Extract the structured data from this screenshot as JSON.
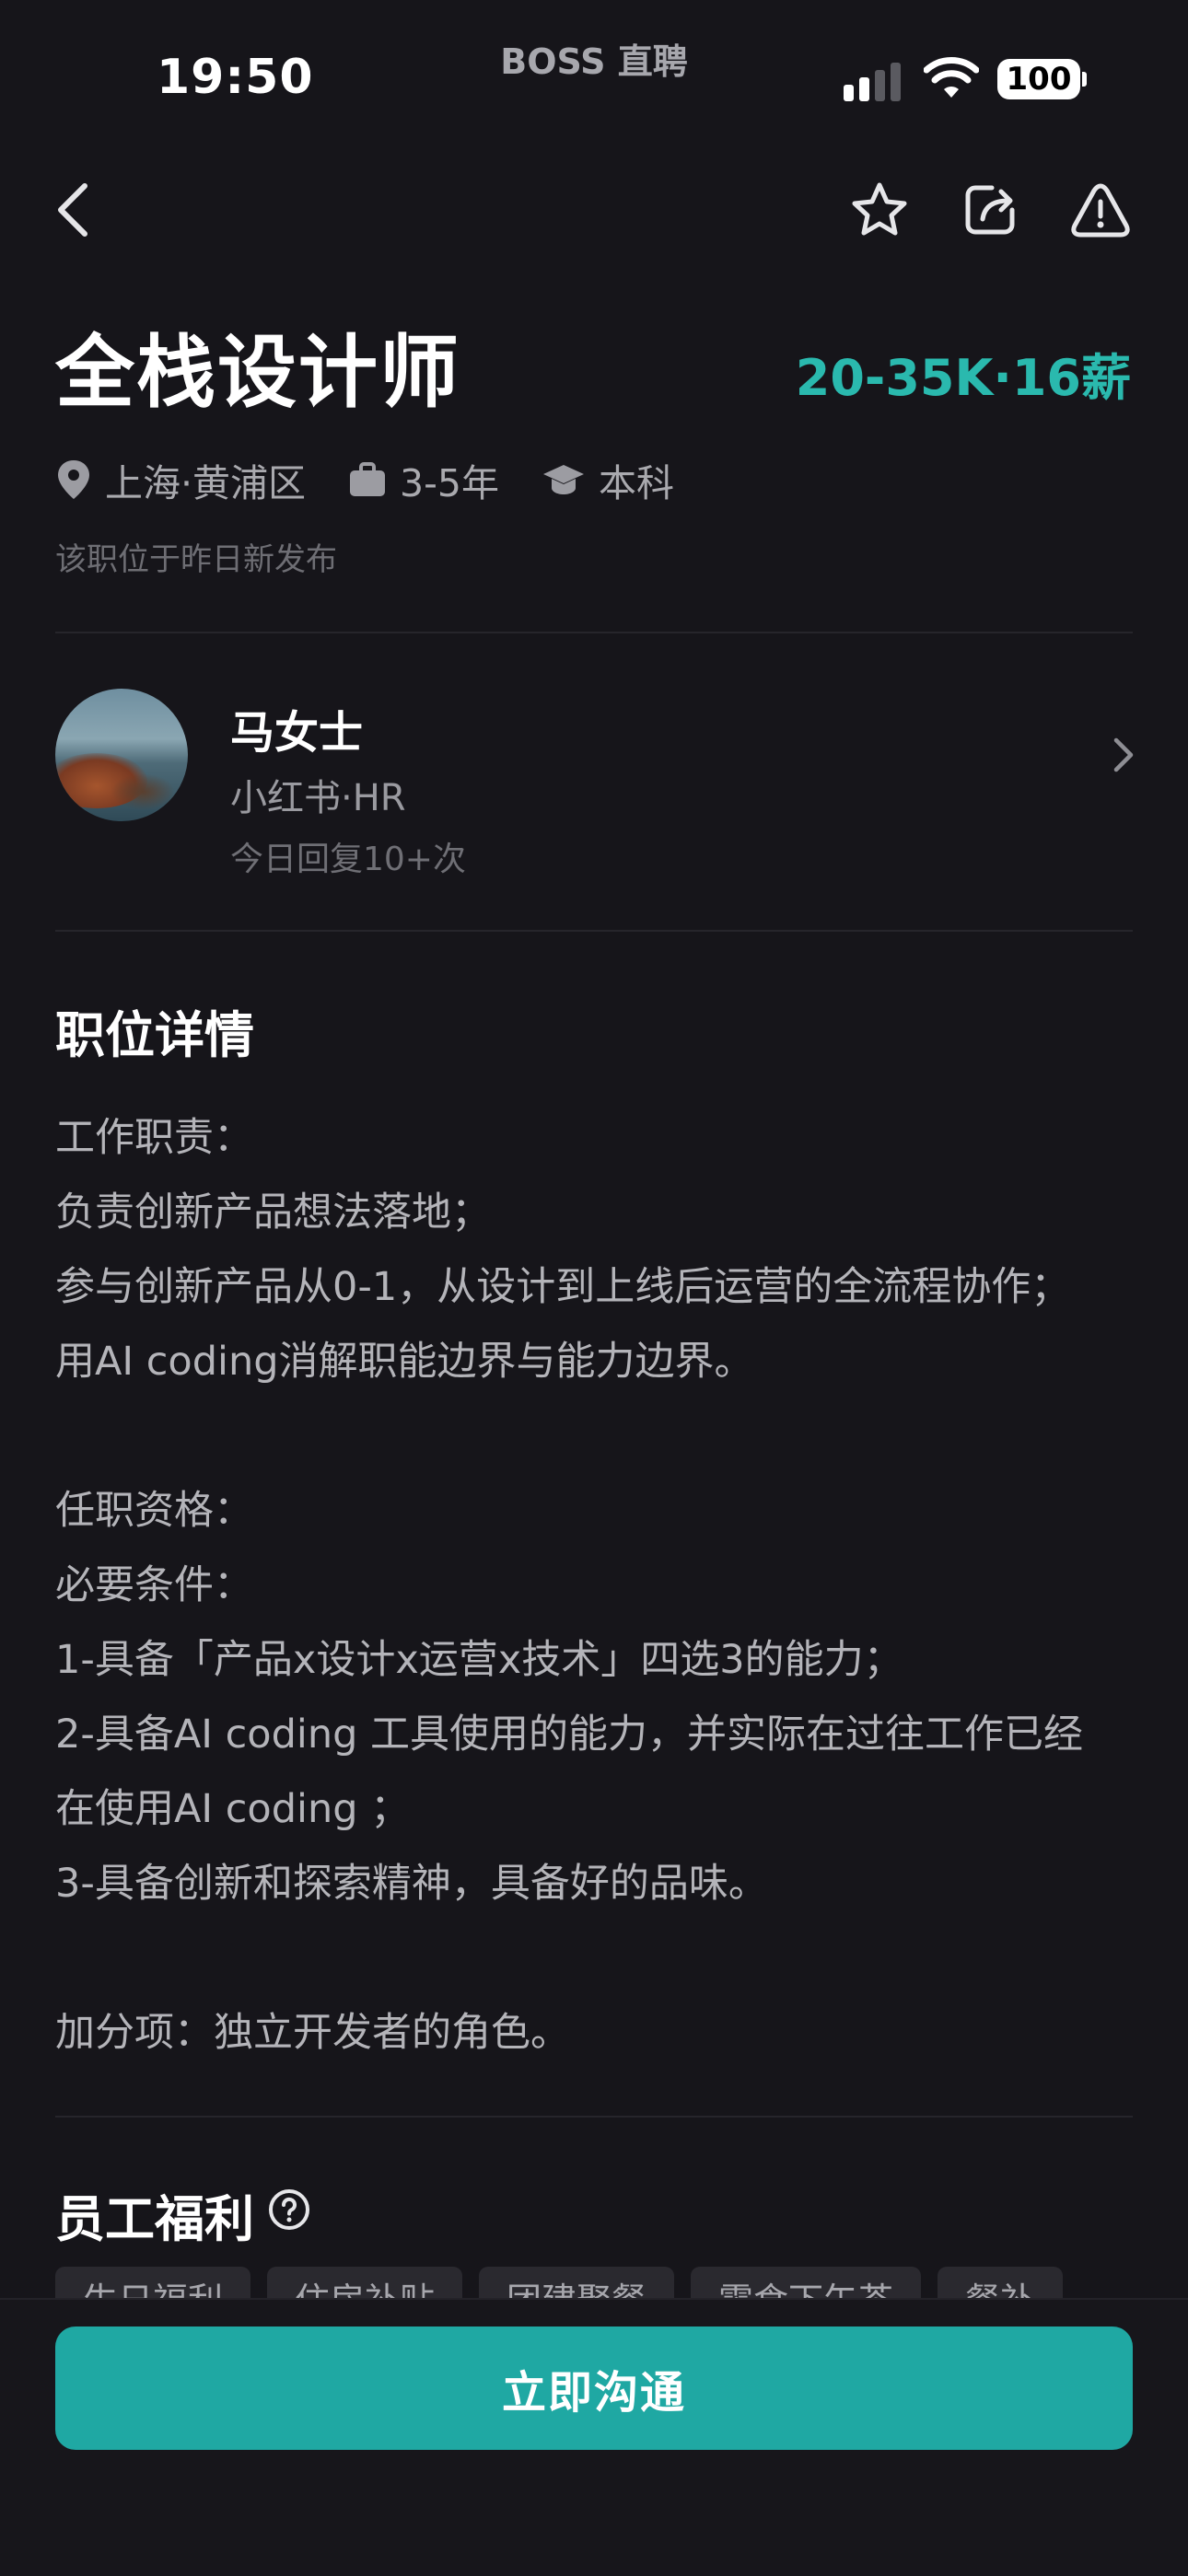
{
  "status_bar": {
    "time": "19:50",
    "carrier": "BOSS 直聘",
    "battery": "100"
  },
  "nav": {
    "back_icon": "chevron-left-icon",
    "favorite_icon": "star-icon",
    "share_icon": "share-icon",
    "report_icon": "alert-triangle-icon"
  },
  "job": {
    "title": "全栈设计师",
    "salary": "20-35K·16薪",
    "location": "上海·黄浦区",
    "experience": "3-5年",
    "education": "本科",
    "published": "该职位于昨日新发布"
  },
  "recruiter": {
    "name": "马女士",
    "company_role": "小红书·HR",
    "reply_stats": "今日回复10+次"
  },
  "details": {
    "title": "职位详情",
    "lines": [
      "工作职责：",
      "负责创新产品想法落地；",
      "参与创新产品从0-1，从设计到上线后运营的全流程协作；",
      "用AI coding消解职能边界与能力边界。",
      "",
      "任职资格：",
      "必要条件：",
      "1-具备「产品x设计x运营x技术」四选3的能力；",
      "2-具备AI coding 工具使用的能力，并实际在过往工作已经",
      "在使用AI coding ；",
      "3-具备创新和探索精神，具备好的品味。",
      "",
      "加分项：独立开发者的角色。"
    ]
  },
  "benefits": {
    "title": "员工福利",
    "tags": [
      "生日福利",
      "住房补贴",
      "团建聚餐",
      "零食下午茶",
      "餐补"
    ]
  },
  "cta": {
    "label": "立即沟通"
  },
  "colors": {
    "accent": "#2ab9ae",
    "button": "#1fa8a3",
    "background": "#16151a"
  }
}
